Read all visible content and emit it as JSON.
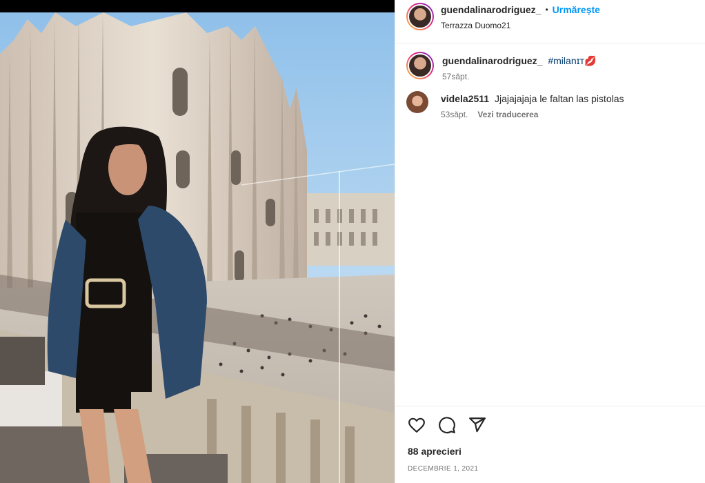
{
  "post": {
    "author": "guendalinarodriguez_",
    "separator": "•",
    "follow_label": "Urmărește",
    "location": "Terrazza Duomo21"
  },
  "caption": {
    "username": "guendalinarodriguez_",
    "hashtag": "#milanɪᴛ",
    "emoji": "💋",
    "time": "57săpt."
  },
  "comments": [
    {
      "username": "videla2511",
      "text": "Jjajajajaja le faltan las pistolas",
      "time": "53săpt.",
      "translate_label": "Vezi traducerea"
    }
  ],
  "actions": {
    "like_icon": "heart-icon",
    "comment_icon": "comment-icon",
    "share_icon": "share-icon"
  },
  "likes": "88 aprecieri",
  "date": "DECEMBRIE 1, 2021",
  "colors": {
    "follow": "#0095f6",
    "hashtag": "#00376b",
    "muted": "#737373"
  }
}
